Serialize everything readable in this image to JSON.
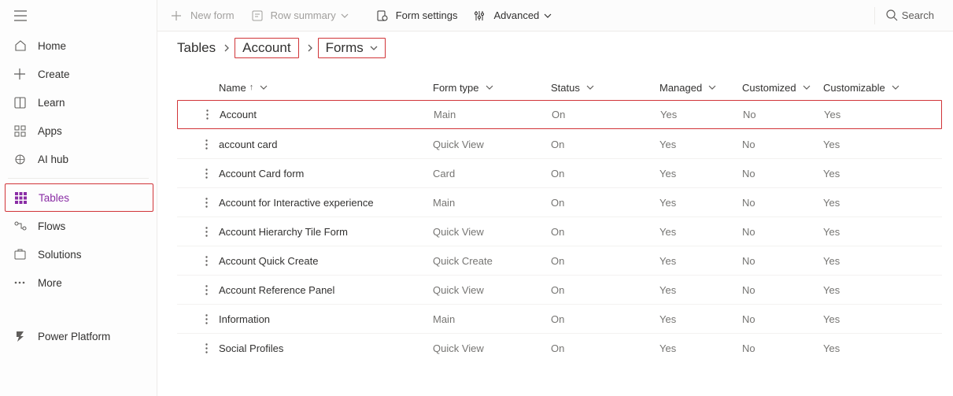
{
  "sidebar": {
    "items": [
      {
        "label": "Home"
      },
      {
        "label": "Create"
      },
      {
        "label": "Learn"
      },
      {
        "label": "Apps"
      },
      {
        "label": "AI hub"
      },
      {
        "label": "Tables"
      },
      {
        "label": "Flows"
      },
      {
        "label": "Solutions"
      },
      {
        "label": "More"
      },
      {
        "label": "Power Platform"
      }
    ]
  },
  "toolbar": {
    "new_form": "New form",
    "row_summary": "Row summary",
    "form_settings": "Form settings",
    "advanced": "Advanced",
    "search": "Search"
  },
  "breadcrumb": {
    "root": "Tables",
    "entity": "Account",
    "page": "Forms"
  },
  "columns": {
    "name": "Name",
    "form_type": "Form type",
    "status": "Status",
    "managed": "Managed",
    "customized": "Customized",
    "customizable": "Customizable"
  },
  "rows": [
    {
      "name": "Account",
      "form_type": "Main",
      "status": "On",
      "managed": "Yes",
      "customized": "No",
      "customizable": "Yes"
    },
    {
      "name": "account card",
      "form_type": "Quick View",
      "status": "On",
      "managed": "Yes",
      "customized": "No",
      "customizable": "Yes"
    },
    {
      "name": "Account Card form",
      "form_type": "Card",
      "status": "On",
      "managed": "Yes",
      "customized": "No",
      "customizable": "Yes"
    },
    {
      "name": "Account for Interactive experience",
      "form_type": "Main",
      "status": "On",
      "managed": "Yes",
      "customized": "No",
      "customizable": "Yes"
    },
    {
      "name": "Account Hierarchy Tile Form",
      "form_type": "Quick View",
      "status": "On",
      "managed": "Yes",
      "customized": "No",
      "customizable": "Yes"
    },
    {
      "name": "Account Quick Create",
      "form_type": "Quick Create",
      "status": "On",
      "managed": "Yes",
      "customized": "No",
      "customizable": "Yes"
    },
    {
      "name": "Account Reference Panel",
      "form_type": "Quick View",
      "status": "On",
      "managed": "Yes",
      "customized": "No",
      "customizable": "Yes"
    },
    {
      "name": "Information",
      "form_type": "Main",
      "status": "On",
      "managed": "Yes",
      "customized": "No",
      "customizable": "Yes"
    },
    {
      "name": "Social Profiles",
      "form_type": "Quick View",
      "status": "On",
      "managed": "Yes",
      "customized": "No",
      "customizable": "Yes"
    }
  ]
}
